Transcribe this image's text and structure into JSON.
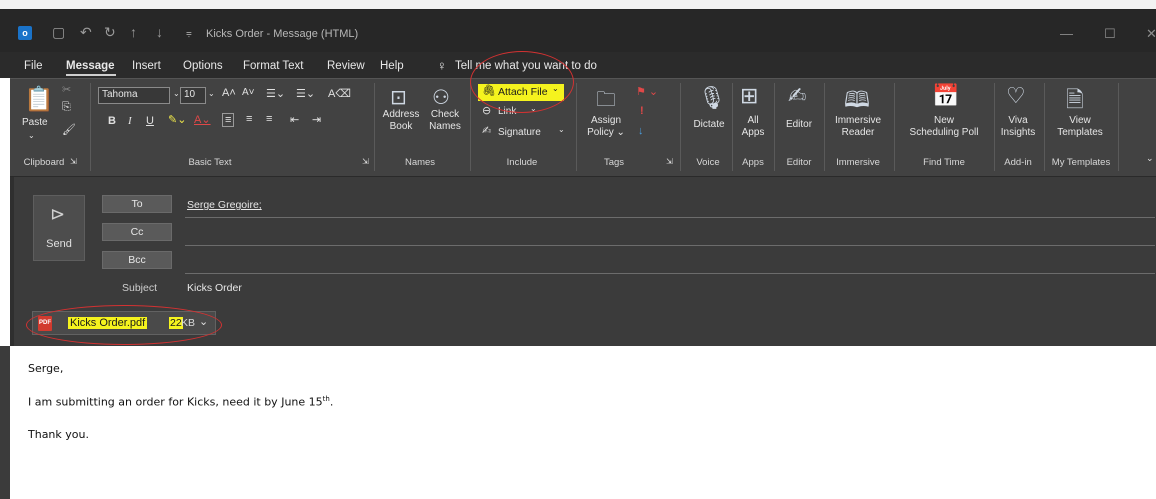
{
  "window": {
    "title": "Kicks Order  -  Message (HTML)",
    "app_icon_glyph": "o",
    "qat_icons": [
      "save-icon",
      "undo-icon",
      "redo-icon",
      "up-arrow-icon",
      "down-arrow-icon",
      "customize-icon"
    ],
    "controls": {
      "minimize": "—",
      "maximize": "☐",
      "close": "✕"
    }
  },
  "menu": {
    "items": [
      "File",
      "Message",
      "Insert",
      "Options",
      "Format Text",
      "Review",
      "Help"
    ],
    "active": "Message",
    "tell_me": "Tell me what you want to do"
  },
  "ribbon": {
    "clipboard": {
      "paste": "Paste",
      "label": "Clipboard"
    },
    "basic_text": {
      "font": "Tahoma",
      "size": "10",
      "label": "Basic Text"
    },
    "names": {
      "address_book": [
        "Address",
        "Book"
      ],
      "check_names": [
        "Check",
        "Names"
      ],
      "label": "Names"
    },
    "include": {
      "attach_file": "Attach File",
      "link": "Link",
      "signature": "Signature",
      "label": "Include"
    },
    "tags": {
      "assign_policy": [
        "Assign",
        "Policy"
      ],
      "label": "Tags"
    },
    "voice": {
      "dictate": "Dictate",
      "label": "Voice"
    },
    "apps": {
      "all_apps": [
        "All",
        "Apps"
      ],
      "label": "Apps"
    },
    "editor": {
      "editor": "Editor",
      "label": "Editor"
    },
    "immersive": {
      "reader": [
        "Immersive",
        "Reader"
      ],
      "label": "Immersive"
    },
    "find_time": {
      "poll": [
        "New",
        "Scheduling Poll"
      ],
      "label": "Find Time"
    },
    "addin": {
      "viva": [
        "Viva",
        "Insights"
      ],
      "label": "Add-in"
    },
    "templates": {
      "view": [
        "View",
        "Templates"
      ],
      "label": "My Templates"
    }
  },
  "compose": {
    "send": "Send",
    "to_label": "To",
    "cc_label": "Cc",
    "bcc_label": "Bcc",
    "to_value": "Serge Gregoire;",
    "subject_label": "Subject",
    "subject_value": "Kicks Order",
    "attachment": {
      "name": "Kicks Order.pdf",
      "size_a": "22",
      "size_b": "KB",
      "type_glyph": "PDF"
    }
  },
  "body": {
    "greeting": "Serge,",
    "line_before_sup": "I am submitting an order for Kicks, need it by June 15",
    "sup": "th",
    "line_after_sup": ".",
    "closing": "Thank you."
  },
  "colors": {
    "highlight": "#f5f31e",
    "annotation": "#d23232",
    "accent": "#1a73c9"
  }
}
